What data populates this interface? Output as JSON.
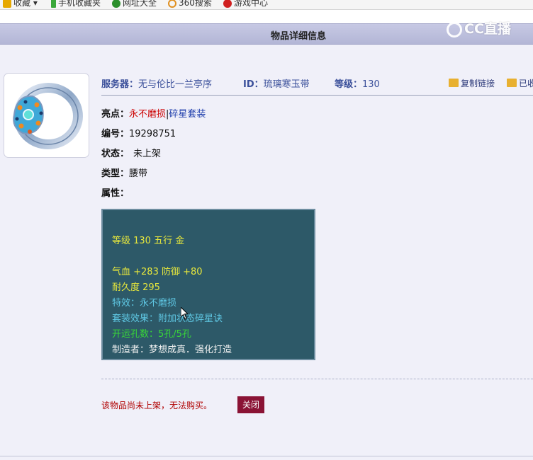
{
  "browser_bookmarks": [
    {
      "label": "收藏",
      "icon": "star-icon",
      "color": "#e6a800"
    },
    {
      "label": "手机收藏夹",
      "icon": "phone-icon",
      "color": "#3aa83a"
    },
    {
      "label": "网址大全",
      "icon": "plus-circle-icon",
      "color": "#2b8f2b"
    },
    {
      "label": "360搜索",
      "icon": "ring-icon",
      "color": "#e09020"
    },
    {
      "label": "游戏中心",
      "icon": "game-icon",
      "color": "#d02020"
    }
  ],
  "watermark": "CC直播",
  "page_title": "物品详细信息",
  "header": {
    "server_label": "服务器：",
    "server_value": "无与伦比一兰亭序",
    "id_label": "ID：",
    "id_value": "琉璃寒玉带",
    "level_label": "等级：",
    "level_value": "130",
    "copy_link": "复制链接",
    "already_label": "已收"
  },
  "item": {
    "highlight_label": "亮点：",
    "highlight_value_1": "永不磨损",
    "highlight_sep": "|",
    "highlight_value_2": "碎星套装",
    "number_label": "编号：",
    "number_value": "19298751",
    "status_label": "状态：",
    "status_value": "未上架",
    "type_label": "类型：",
    "type_value": "腰带",
    "attr_label": "属性："
  },
  "attributes": {
    "line1": "等级 130 五行 金",
    "line2": "气血 +283 防御 +80",
    "line3": "耐久度 295",
    "line4": "特效：永不磨损",
    "line5": "套装效果：附加状态碎星诀",
    "line6": "开运孔数：5孔/5孔",
    "line7": "制造者：梦想成真．强化打造"
  },
  "footer": {
    "notice": "该物品尚未上架，无法购买。",
    "close_button": "关闭"
  },
  "colors": {
    "title_bar": "#b3b6d6",
    "attr_box_bg": "#2d5968",
    "close_button_bg": "#8a1335",
    "label_blue": "#3a4f9a",
    "highlight_red": "#cc0000"
  }
}
